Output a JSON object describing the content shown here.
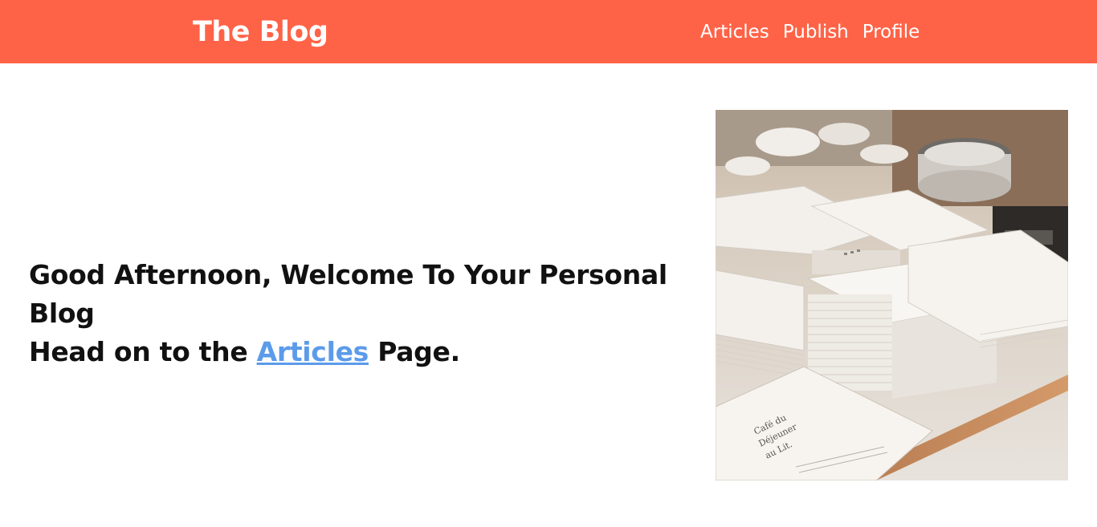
{
  "header": {
    "brand": "The Blog",
    "nav": [
      {
        "label": "Articles"
      },
      {
        "label": "Publish"
      },
      {
        "label": "Profile"
      }
    ]
  },
  "hero": {
    "line1": "Good Afternoon, Welcome To Your Personal Blog",
    "line2_prefix": "Head on to the ",
    "link_text": "Articles",
    "line2_suffix": " Page."
  },
  "photo": {
    "card_text_1": "Café du",
    "card_text_2": "Déjeuner",
    "card_text_3": "au Lit."
  },
  "colors": {
    "header_bg": "#ff6347",
    "link": "#5b9bea"
  }
}
